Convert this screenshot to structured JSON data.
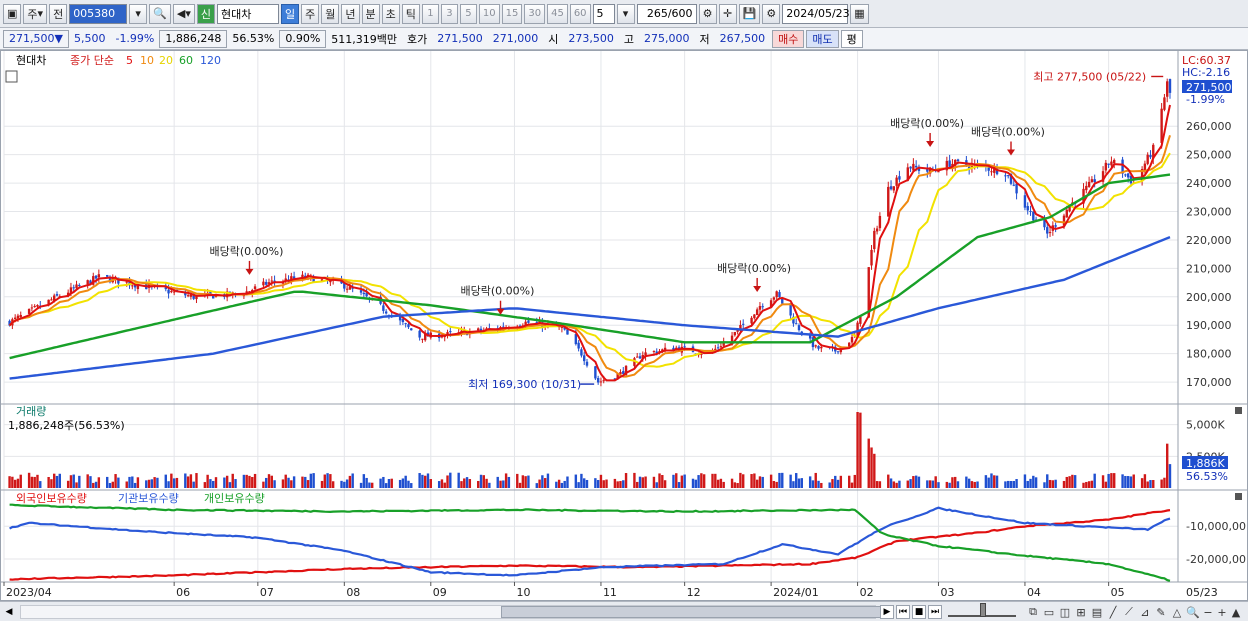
{
  "toolbar": {
    "period_type": "주",
    "prev_label": "전",
    "stock_code": "005380",
    "new_badge": "신",
    "stock_name": "현대차",
    "periods": [
      "일",
      "주",
      "월",
      "년",
      "분",
      "초",
      "틱"
    ],
    "selected_period": "일",
    "intervals": [
      "1",
      "3",
      "5",
      "10",
      "15",
      "30",
      "45",
      "60"
    ],
    "interval_value": "5",
    "count_value": "265",
    "count_total": "/600",
    "date": "2024/05/23"
  },
  "quote": {
    "price": "271,500",
    "change": "5,500",
    "change_pct": "-1.99%",
    "volume": "1,886,248",
    "vol_ratio": "56.53%",
    "turnover_rate": "0.90%",
    "trade_value": "511,319백만",
    "bid_label": "호가",
    "ask": "271,500",
    "bid": "271,000",
    "open_label": "시",
    "open": "273,500",
    "high_label": "고",
    "high": "275,000",
    "low_label": "저",
    "low": "267,500",
    "buy": "매수",
    "sell": "매도",
    "eval": "평"
  },
  "colors": {
    "up": "#d01818",
    "down": "#1f4fd0",
    "ma5": "#e01010",
    "ma10": "#f08a10",
    "ma20": "#f2e200",
    "ma60": "#18a028",
    "ma120": "#2a58d8",
    "foreign": "#e01010",
    "institution": "#2a58d8",
    "individual": "#18a028"
  },
  "chart_data": [
    {
      "type": "candlestick",
      "legend": {
        "name": "현대차",
        "close_label": "종가 단순",
        "ma_periods": [
          "5",
          "10",
          "20",
          "60",
          "120"
        ]
      },
      "ylim": [
        163000,
        284000
      ],
      "y_ticks": [
        170000,
        180000,
        190000,
        200000,
        210000,
        220000,
        230000,
        240000,
        250000,
        260000
      ],
      "y_tick_labels": [
        "170,000",
        "180,000",
        "190,000",
        "200,000",
        "210,000",
        "220,000",
        "230,000",
        "240,000",
        "250,000",
        "260,000"
      ],
      "current_price_label": "271,500",
      "current_change_label": "-1.99%",
      "lc_label": "LC:60.37",
      "hc_label": "HC:-2.16",
      "price_keys": [
        [
          "2023-04-01",
          190000
        ],
        [
          "2023-04-20",
          200000
        ],
        [
          "2023-05-05",
          207000
        ],
        [
          "2023-05-25",
          203000
        ],
        [
          "2023-06-08",
          200000
        ],
        [
          "2023-06-25",
          201000
        ],
        [
          "2023-07-05",
          205000
        ],
        [
          "2023-07-18",
          207000
        ],
        [
          "2023-08-01",
          204000
        ],
        [
          "2023-08-12",
          198000
        ],
        [
          "2023-08-28",
          186000
        ],
        [
          "2023-09-10",
          187000
        ],
        [
          "2023-09-25",
          189000
        ],
        [
          "2023-10-05",
          191000
        ],
        [
          "2023-10-18",
          189000
        ],
        [
          "2023-10-25",
          180000
        ],
        [
          "2023-10-31",
          170000
        ],
        [
          "2023-11-08",
          173000
        ],
        [
          "2023-11-16",
          180000
        ],
        [
          "2023-11-28",
          182000
        ],
        [
          "2023-12-10",
          180000
        ],
        [
          "2023-12-20",
          188000
        ],
        [
          "2023-12-28",
          197000
        ],
        [
          "2024-01-03",
          201000
        ],
        [
          "2024-01-10",
          190000
        ],
        [
          "2024-01-17",
          182000
        ],
        [
          "2024-01-24",
          181000
        ],
        [
          "2024-01-31",
          186000
        ],
        [
          "2024-02-03",
          198000
        ],
        [
          "2024-02-07",
          222000
        ],
        [
          "2024-02-12",
          238000
        ],
        [
          "2024-02-19",
          246000
        ],
        [
          "2024-02-27",
          244000
        ],
        [
          "2024-03-05",
          247000
        ],
        [
          "2024-03-15",
          246000
        ],
        [
          "2024-03-25",
          244000
        ],
        [
          "2024-04-01",
          232000
        ],
        [
          "2024-04-09",
          222000
        ],
        [
          "2024-04-17",
          232000
        ],
        [
          "2024-04-25",
          240000
        ],
        [
          "2024-05-02",
          248000
        ],
        [
          "2024-05-10",
          240000
        ],
        [
          "2024-05-17",
          252000
        ],
        [
          "2024-05-22",
          275000
        ],
        [
          "2024-05-23",
          271500
        ]
      ],
      "ma_keys": {
        "ma60": [
          [
            "2023-04-01",
            178000
          ],
          [
            "2023-06-01",
            192000
          ],
          [
            "2023-07-15",
            202000
          ],
          [
            "2023-09-01",
            197000
          ],
          [
            "2023-10-15",
            191000
          ],
          [
            "2023-12-01",
            184000
          ],
          [
            "2024-01-15",
            184000
          ],
          [
            "2024-02-15",
            200000
          ],
          [
            "2024-03-15",
            221000
          ],
          [
            "2024-04-10",
            228000
          ],
          [
            "2024-05-01",
            240000
          ],
          [
            "2024-05-23",
            243000
          ]
        ],
        "ma120": [
          [
            "2023-04-01",
            171000
          ],
          [
            "2023-06-15",
            180000
          ],
          [
            "2023-08-15",
            193000
          ],
          [
            "2023-10-01",
            196000
          ],
          [
            "2023-12-01",
            190000
          ],
          [
            "2024-01-25",
            186000
          ],
          [
            "2024-03-01",
            196000
          ],
          [
            "2024-04-15",
            206000
          ],
          [
            "2024-05-23",
            221000
          ]
        ]
      },
      "annotations": [
        {
          "label": "배당락(0.00%)",
          "date": "2023-06-28",
          "value": 207000
        },
        {
          "label": "배당락(0.00%)",
          "date": "2023-09-26",
          "value": 193000
        },
        {
          "label": "배당락(0.00%)",
          "date": "2023-12-27",
          "value": 201000
        },
        {
          "label": "배당락(0.00%)",
          "date": "2024-02-27",
          "value": 252000
        },
        {
          "label": "배당락(0.00%)",
          "date": "2024-03-27",
          "value": 249000
        }
      ],
      "high_note": {
        "label": "최고 277,500 (05/22)",
        "date": "2024-05-22",
        "value": 277500
      },
      "low_note": {
        "label": "최저 169,300 (10/31)",
        "date": "2023-10-31",
        "value": 169300
      }
    },
    {
      "type": "bar",
      "title": "거래량",
      "subtitle": "1,886,248주(56.53%)",
      "ylim": [
        0,
        6000000
      ],
      "y_ticks": [
        2500000,
        5000000
      ],
      "y_tick_labels": [
        "2,500K",
        "5,000K"
      ],
      "current_label": "1,886K",
      "current_pct_label": "56.53%",
      "base_volume": 1100000,
      "spikes": [
        {
          "date": "2024-02-01",
          "value": 6000000
        },
        {
          "date": "2024-02-02",
          "value": 5950000
        },
        {
          "date": "2024-02-05",
          "value": 3900000
        },
        {
          "date": "2024-02-06",
          "value": 3200000
        },
        {
          "date": "2024-02-07",
          "value": 2700000
        },
        {
          "date": "2024-05-22",
          "value": 3500000
        },
        {
          "date": "2024-05-23",
          "value": 1886248
        }
      ]
    },
    {
      "type": "line",
      "legend": [
        "외국인보유수량",
        "기관보유수량",
        "개인보유수량"
      ],
      "y_ticks": [
        -10000000,
        -20000000
      ],
      "y_tick_labels": [
        "-10,000,00",
        "-20,000,00"
      ],
      "ylim": [
        -27000000,
        -2000000
      ],
      "series": [
        {
          "name": "외국인보유수량",
          "key": "foreign",
          "points": [
            [
              "2023-04-01",
              -26200000
            ],
            [
              "2023-06-01",
              -25000000
            ],
            [
              "2023-08-01",
              -23000000
            ],
            [
              "2023-10-01",
              -22000000
            ],
            [
              "2023-11-15",
              -22500000
            ],
            [
              "2024-01-15",
              -21500000
            ],
            [
              "2024-02-01",
              -19500000
            ],
            [
              "2024-02-15",
              -14500000
            ],
            [
              "2024-03-15",
              -12000000
            ],
            [
              "2024-04-01",
              -10000000
            ],
            [
              "2024-05-01",
              -8000000
            ],
            [
              "2024-05-23",
              -5000000
            ]
          ]
        },
        {
          "name": "기관보유수량",
          "key": "institution",
          "points": [
            [
              "2023-04-01",
              -11000000
            ],
            [
              "2023-04-10",
              -9000000
            ],
            [
              "2023-05-20",
              -11500000
            ],
            [
              "2023-07-01",
              -13500000
            ],
            [
              "2023-08-01",
              -17500000
            ],
            [
              "2023-09-01",
              -24000000
            ],
            [
              "2023-10-01",
              -25000000
            ],
            [
              "2023-11-01",
              -22500000
            ],
            [
              "2023-12-15",
              -21500000
            ],
            [
              "2024-01-05",
              -15500000
            ],
            [
              "2024-01-25",
              -18500000
            ],
            [
              "2024-02-10",
              -10500000
            ],
            [
              "2024-03-01",
              -4500000
            ],
            [
              "2024-04-01",
              -9000000
            ],
            [
              "2024-05-15",
              -11000000
            ],
            [
              "2024-05-23",
              -7500000
            ]
          ]
        },
        {
          "name": "개인보유수량",
          "key": "individual",
          "points": [
            [
              "2023-04-01",
              -3500000
            ],
            [
              "2023-06-01",
              -5000000
            ],
            [
              "2023-08-01",
              -5500000
            ],
            [
              "2023-10-01",
              -5000000
            ],
            [
              "2023-12-01",
              -5500000
            ],
            [
              "2024-01-31",
              -5000000
            ],
            [
              "2024-02-10",
              -12500000
            ],
            [
              "2024-03-01",
              -16000000
            ],
            [
              "2024-04-01",
              -19000000
            ],
            [
              "2024-05-01",
              -21500000
            ],
            [
              "2024-05-23",
              -26500000
            ]
          ]
        }
      ]
    }
  ],
  "x_axis": {
    "start": "2023-04-01",
    "end": "2024-05-23",
    "ticks": [
      {
        "date": "2023-04-01",
        "label": "2023/04"
      },
      {
        "date": "2023-06-01",
        "label": "06"
      },
      {
        "date": "2023-07-01",
        "label": "07"
      },
      {
        "date": "2023-08-01",
        "label": "08"
      },
      {
        "date": "2023-09-01",
        "label": "09"
      },
      {
        "date": "2023-10-01",
        "label": "10"
      },
      {
        "date": "2023-11-01",
        "label": "11"
      },
      {
        "date": "2023-12-01",
        "label": "12"
      },
      {
        "date": "2024-01-01",
        "label": "2024/01"
      },
      {
        "date": "2024-02-01",
        "label": "02"
      },
      {
        "date": "2024-03-01",
        "label": "03"
      },
      {
        "date": "2024-04-01",
        "label": "04"
      },
      {
        "date": "2024-05-01",
        "label": "05"
      }
    ],
    "right_label": "05/23"
  }
}
